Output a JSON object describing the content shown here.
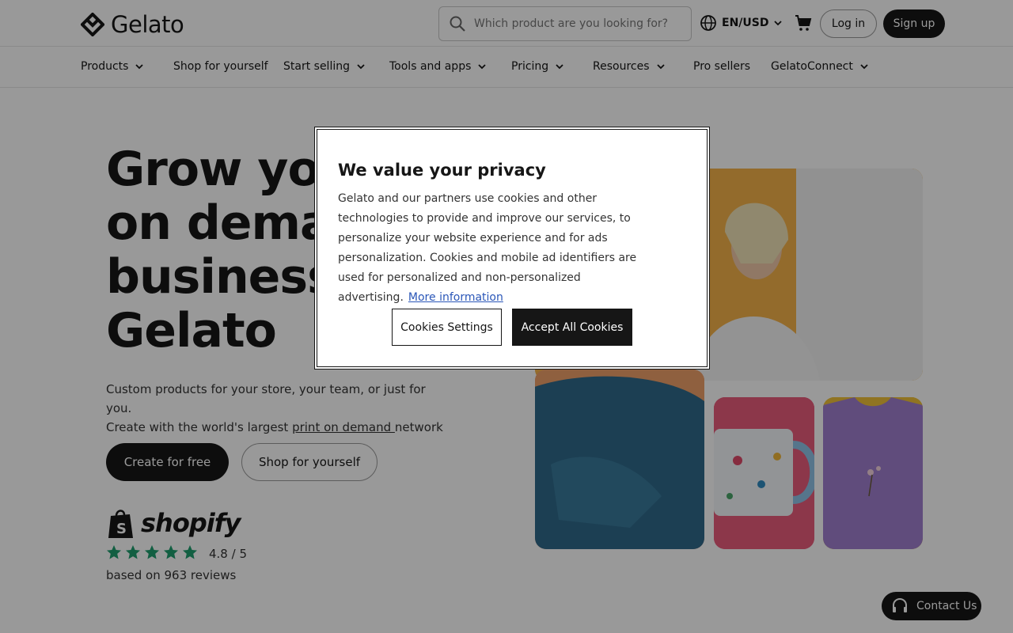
{
  "header": {
    "logo_text": "Gelato",
    "search_placeholder": "Which product are you looking for?",
    "language": "EN/USD",
    "login_label": "Log in",
    "signup_label": "Sign up"
  },
  "nav": {
    "items": [
      {
        "label": "Products",
        "dropdown": true
      },
      {
        "label": "Shop for yourself",
        "dropdown": false
      },
      {
        "label": "Start selling",
        "dropdown": true
      },
      {
        "label": "Tools and apps",
        "dropdown": true
      },
      {
        "label": "Pricing",
        "dropdown": true
      },
      {
        "label": "Resources",
        "dropdown": true
      },
      {
        "label": "Pro sellers",
        "dropdown": false
      },
      {
        "label": "GelatoConnect",
        "dropdown": true
      }
    ]
  },
  "hero": {
    "title_lines": [
      "Grow your print",
      "on demand",
      "business with",
      "Gelato"
    ],
    "subtitle_line1": "Custom products for your store, your team, or just for you.",
    "subtitle_line2_pre": "Create with the world's largest ",
    "subtitle_link": "print on demand ",
    "subtitle_line2_post": "network",
    "cta_primary": "Create for free",
    "cta_secondary": "Shop for yourself",
    "shopify_word": "shopify",
    "rating_value": "4.8 / 5",
    "rating_stars": 5,
    "reviews_text": "based on 963 reviews",
    "images": {
      "people": "two people looking at phones",
      "sweatshirt": "teal sweatshirt",
      "mug": "floral mug",
      "tshirt": "purple t-shirt"
    }
  },
  "cookie_modal": {
    "title": "We value your privacy",
    "body": "Gelato and our partners use cookies and other technologies to provide and improve our services, to personalize your website experience and for ads personalization. Cookies and mobile ad identifiers are used for personalized and non-personalized advertising.",
    "more_info_link": "More information",
    "settings_label": "Cookies Settings",
    "accept_label": "Accept All Cookies"
  },
  "contact": {
    "label": "Contact Us"
  },
  "colors": {
    "brand_dark": "#161616",
    "star_green": "#1e9e6e",
    "link_blue": "#2a56b8"
  }
}
